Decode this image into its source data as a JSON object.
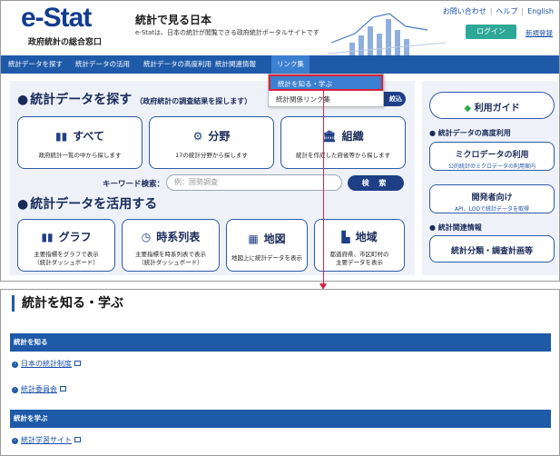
{
  "header": {
    "logo_main": "e-Stat",
    "logo_sub": "政府統計の総合窓口",
    "site_title": "統計で見る日本",
    "site_desc": "e-Statは、日本の統計が閲覧できる政府統計ポータルサイトです",
    "links": [
      "お問い合わせ",
      "ヘルプ",
      "English"
    ],
    "login": "ログイン",
    "register": "新規登録"
  },
  "nav": {
    "items": [
      "統計データを探す",
      "統計データの活用",
      "統計データの高度利用",
      "統計関連情報",
      "リンク集"
    ],
    "dropdown": [
      "統計を知る・学ぶ",
      "統計関係リンク集"
    ]
  },
  "search_section": {
    "title": "統計データを探す",
    "subtitle": "（政府統計の調査結果を探します）",
    "narrow_btn": "絞込",
    "cards": [
      {
        "title": "すべて",
        "desc": "政府統計一覧の中から探します"
      },
      {
        "title": "分野",
        "desc": "17の統計分野から探します"
      },
      {
        "title": "組織",
        "desc": "統計を作成した府省等から探します"
      }
    ],
    "keyword_label": "キーワード検索：",
    "keyword_placeholder": "例：国勢調査",
    "search_btn": "検 索"
  },
  "use_section": {
    "title": "統計データを活用する",
    "cards": [
      {
        "title": "グラフ",
        "desc1": "主要指標をグラフで表示",
        "desc2": "（統計ダッシュボード）"
      },
      {
        "title": "時系列表",
        "desc1": "主要指標を時系列表で表示",
        "desc2": "（統計ダッシュボード）"
      },
      {
        "title": "地図",
        "desc1": "地図上に統計データを表示",
        "desc2": ""
      },
      {
        "title": "地域",
        "desc1": "都道府県、市区町村の",
        "desc2": "主要データを表示"
      }
    ]
  },
  "side": {
    "guide": "利用ガイド",
    "adv_head": "統計データの高度利用",
    "micro_title": "ミクロデータの利用",
    "micro_sub": "公的統計のミクロデータの利用案内",
    "dev_title": "開発者向け",
    "dev_sub": "API、LODで統計データを取得",
    "rel_head": "統計関連情報",
    "classif": "統計分類・調査計画等"
  },
  "bottom": {
    "title": "統計を知る・学ぶ",
    "sections": [
      {
        "heading": "統計を知る",
        "links": [
          "日本の統計制度",
          "統計委員会"
        ]
      },
      {
        "heading": "統計を学ぶ",
        "links": [
          "統計学習サイト"
        ]
      }
    ]
  },
  "colors": {
    "nav": "#1e5aa8",
    "accent_red": "#d8243a",
    "login": "#2ea896"
  }
}
